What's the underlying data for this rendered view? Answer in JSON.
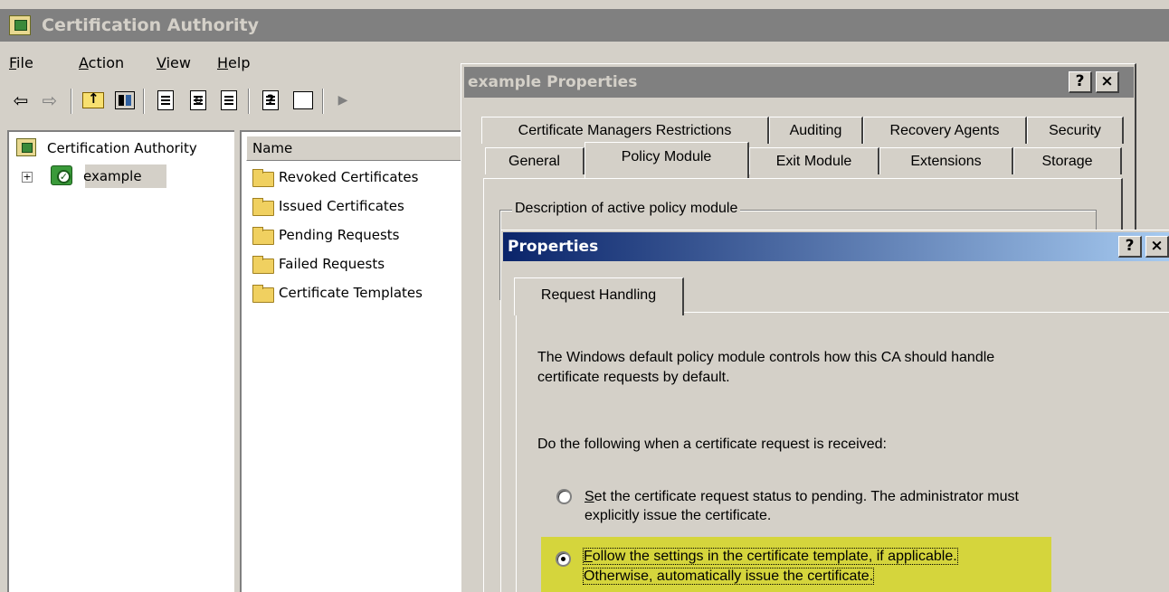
{
  "main_window": {
    "title": "Certification Authority",
    "menu": [
      {
        "label": "File",
        "accel": "F",
        "rest": "ile"
      },
      {
        "label": "Action",
        "accel": "A",
        "rest": "ction"
      },
      {
        "label": "View",
        "accel": "V",
        "rest": "iew"
      },
      {
        "label": "Help",
        "accel": "H",
        "rest": "elp"
      }
    ],
    "toolbar_icons": [
      "back-arrow-icon",
      "forward-arrow-icon",
      "up-folder-icon",
      "show-hide-console-tree-icon",
      "properties-icon",
      "refresh-icon",
      "export-list-icon",
      "help-icon",
      "show-hide-action-pane-icon",
      "play-icon"
    ],
    "tree": {
      "root": "Certification Authority",
      "child": "example"
    },
    "list": {
      "column_header": "Name",
      "items": [
        "Revoked Certificates",
        "Issued Certificates",
        "Pending Requests",
        "Failed Requests",
        "Certificate Templates"
      ]
    }
  },
  "example_dialog": {
    "title": "example Properties",
    "help_btn": "?",
    "close_btn": "×",
    "tabs_row1": [
      "Certificate Managers Restrictions",
      "Auditing",
      "Recovery Agents",
      "Security"
    ],
    "tabs_row2": [
      "General",
      "Policy Module",
      "Exit Module",
      "Extensions",
      "Storage"
    ],
    "active_tab": "Policy Module",
    "groupbox_label": "Description of active policy module"
  },
  "props_dialog": {
    "title": "Properties",
    "help_btn": "?",
    "close_btn": "×",
    "tab": "Request Handling",
    "intro_line1": "The Windows default policy module controls how this CA should handle",
    "intro_line2": "certificate requests by default.",
    "prompt": "Do the following when a certificate request is received:",
    "option1": {
      "accel": "S",
      "line1_rest": "et the certificate request status to pending. The administrator must",
      "line2": "explicitly issue the certificate.",
      "checked": false
    },
    "option2": {
      "accel": "F",
      "line1_rest": "ollow the settings in the certificate template, if applicable.",
      "line2": "Otherwise, automatically issue the certificate.",
      "checked": true
    },
    "highlight_color": "#d5d53c"
  }
}
